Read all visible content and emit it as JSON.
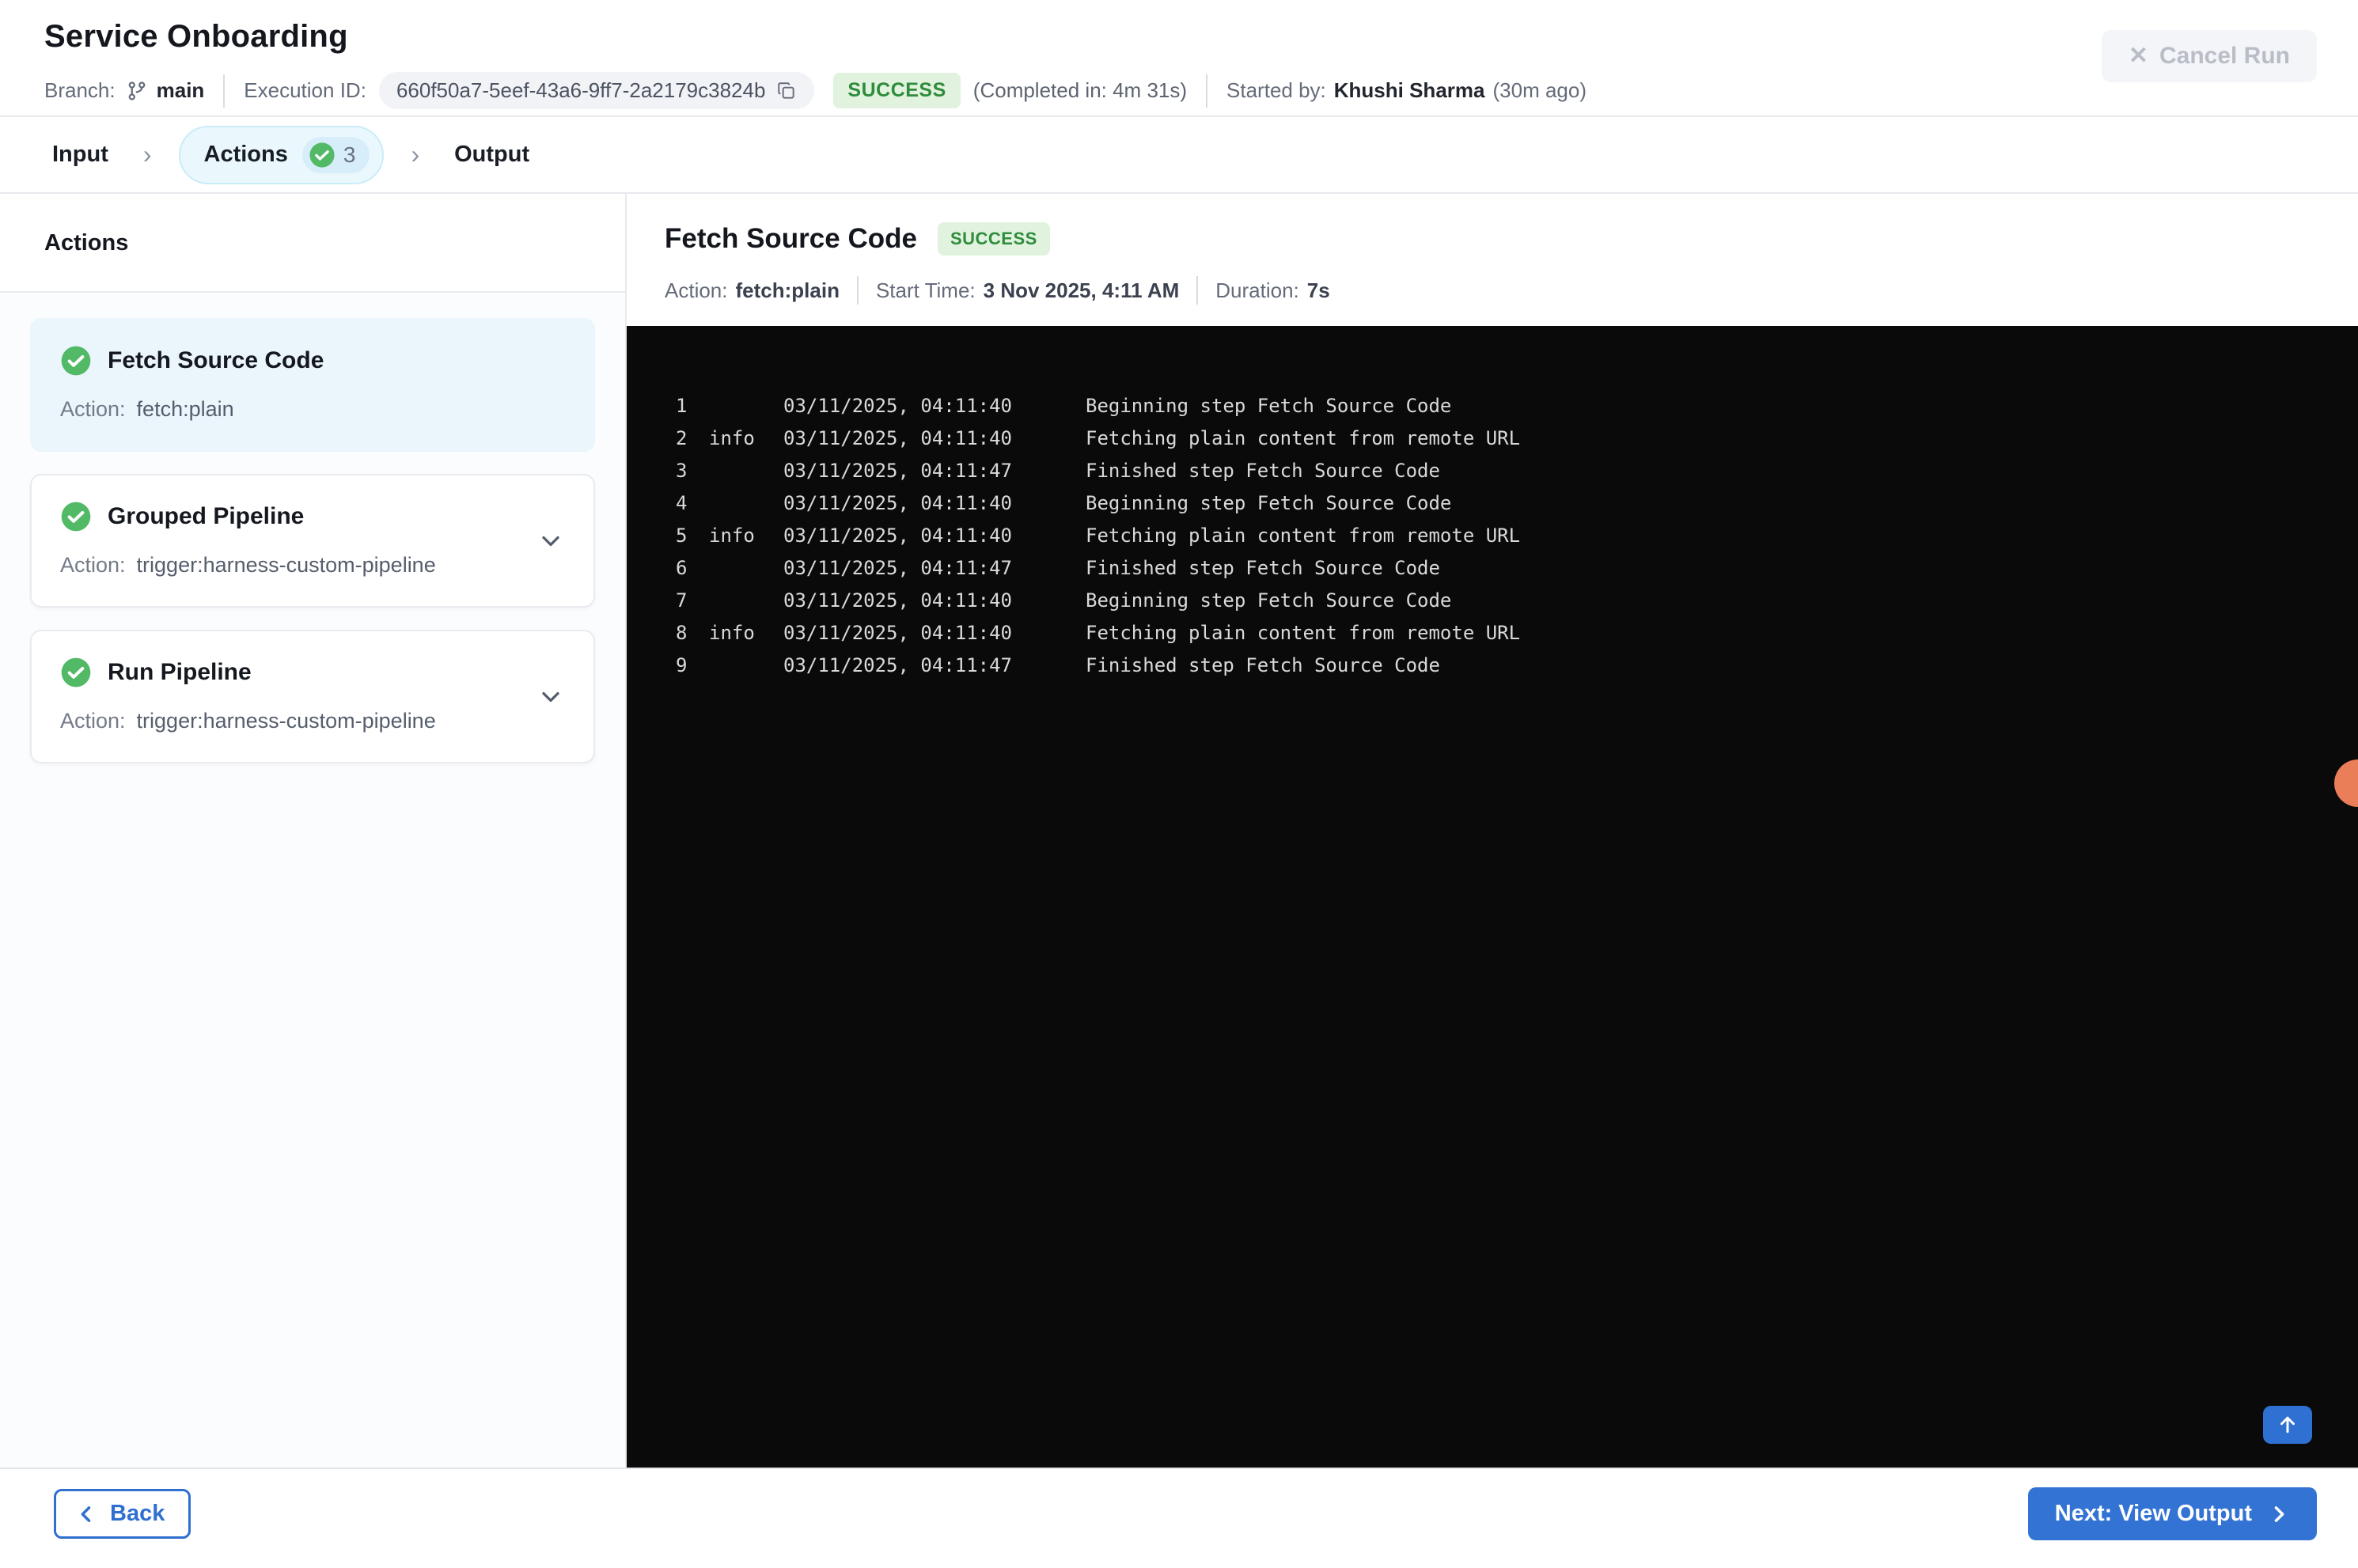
{
  "header": {
    "title": "Service Onboarding",
    "branch_label": "Branch:",
    "branch_value": "main",
    "execution_id_label": "Execution ID:",
    "execution_id": "660f50a7-5eef-43a6-9ff7-2a2179c3824b",
    "status_badge": "SUCCESS",
    "completed_in": "(Completed in: 4m 31s)",
    "started_by_label": "Started by:",
    "started_by_name": "Khushi Sharma",
    "started_ago": "(30m ago)",
    "cancel_button": "Cancel Run"
  },
  "tabs": {
    "input": "Input",
    "actions": "Actions",
    "actions_count": "3",
    "output": "Output"
  },
  "sidebar": {
    "heading": "Actions",
    "items": [
      {
        "title": "Fetch Source Code",
        "action_label": "Action:",
        "action_value": "fetch:plain"
      },
      {
        "title": "Grouped Pipeline",
        "action_label": "Action:",
        "action_value": "trigger:harness-custom-pipeline"
      },
      {
        "title": "Run Pipeline",
        "action_label": "Action:",
        "action_value": "trigger:harness-custom-pipeline"
      }
    ]
  },
  "detail": {
    "title": "Fetch Source Code",
    "status_badge": "SUCCESS",
    "action_label": "Action:",
    "action_value": "fetch:plain",
    "start_time_label": "Start Time:",
    "start_time_value": "3 Nov 2025, 4:11 AM",
    "duration_label": "Duration:",
    "duration_value": "7s"
  },
  "log": {
    "lines": [
      {
        "num": "1",
        "level": "",
        "time": "03/11/2025, 04:11:40",
        "message": "Beginning step Fetch Source Code"
      },
      {
        "num": "2",
        "level": "info",
        "time": "03/11/2025, 04:11:40",
        "message": "Fetching plain content from remote URL"
      },
      {
        "num": "3",
        "level": "",
        "time": "03/11/2025, 04:11:47",
        "message": "Finished step Fetch Source Code"
      },
      {
        "num": "4",
        "level": "",
        "time": "03/11/2025, 04:11:40",
        "message": "Beginning step Fetch Source Code"
      },
      {
        "num": "5",
        "level": "info",
        "time": "03/11/2025, 04:11:40",
        "message": "Fetching plain content from remote URL"
      },
      {
        "num": "6",
        "level": "",
        "time": "03/11/2025, 04:11:47",
        "message": "Finished step Fetch Source Code"
      },
      {
        "num": "7",
        "level": "",
        "time": "03/11/2025, 04:11:40",
        "message": "Beginning step Fetch Source Code"
      },
      {
        "num": "8",
        "level": "info",
        "time": "03/11/2025, 04:11:40",
        "message": "Fetching plain content from remote URL"
      },
      {
        "num": "9",
        "level": "",
        "time": "03/11/2025, 04:11:47",
        "message": "Finished step Fetch Source Code"
      }
    ]
  },
  "footer": {
    "back_button": "Back",
    "next_button": "Next: View Output"
  },
  "colors": {
    "accent_blue": "#3273d4",
    "success_green": "#52b966",
    "success_badge_bg": "#e1f3df",
    "success_badge_text": "#2f8c3c",
    "console_bg": "#0a0a0b",
    "active_tab_bg": "#eaf8fe",
    "selected_card_bg": "#eaf5fc",
    "orange_dot": "#e97e58"
  }
}
